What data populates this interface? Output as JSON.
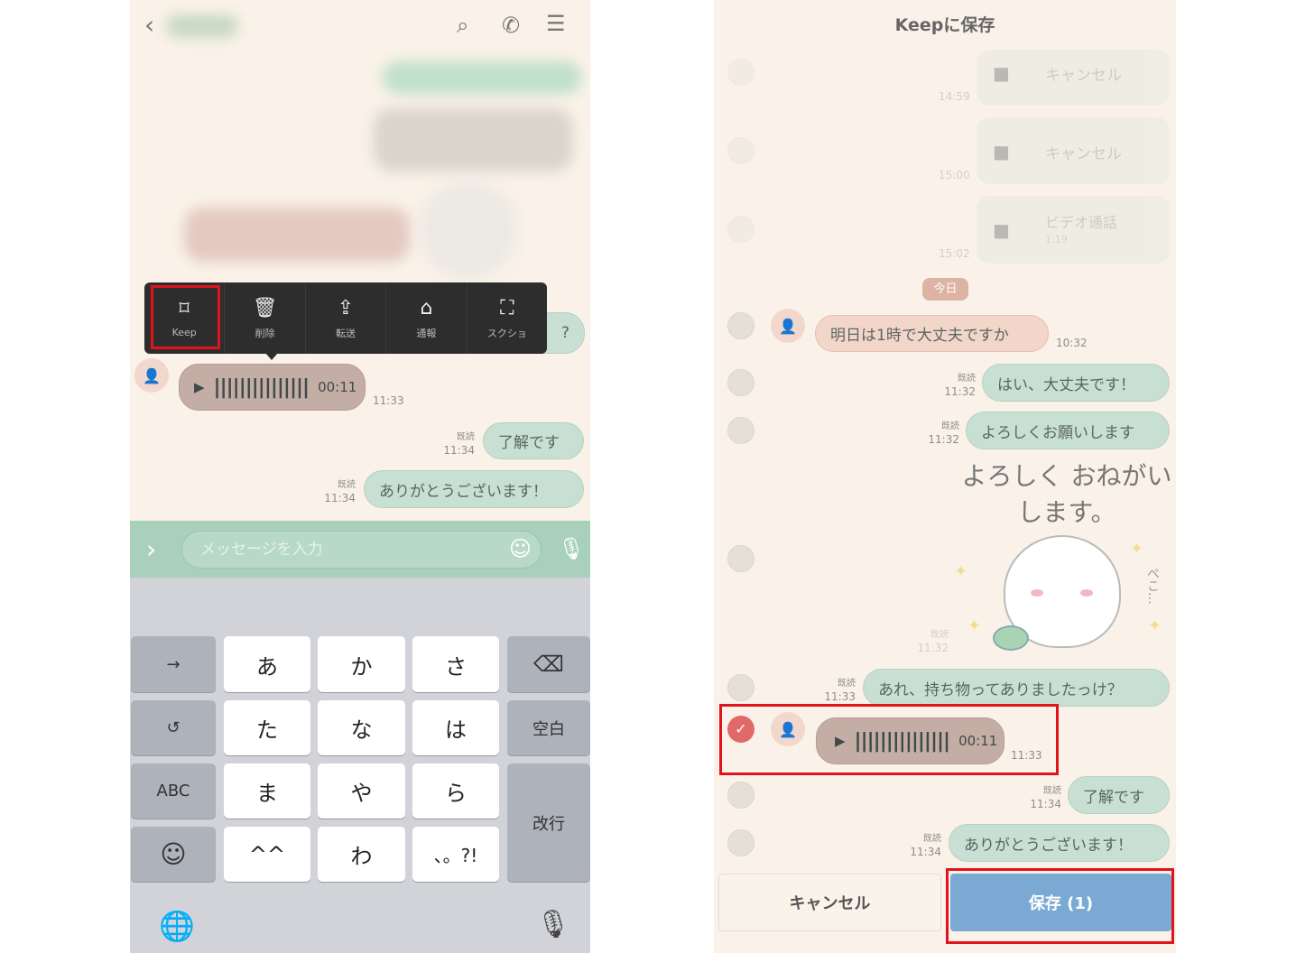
{
  "left": {
    "header": {
      "back_icon": "chevron-left-icon",
      "search_icon": "search-icon",
      "call_icon": "phone-icon",
      "menu_icon": "menu-icon"
    },
    "context_menu": [
      {
        "label": "Keep",
        "icon": "bookmark-icon"
      },
      {
        "label": "削除",
        "icon": "trash-icon"
      },
      {
        "label": "転送",
        "icon": "share-icon"
      },
      {
        "label": "通報",
        "icon": "report-icon"
      },
      {
        "label": "スクショ",
        "icon": "screenshot-icon"
      }
    ],
    "partial_bubble": "?",
    "voice_message": {
      "duration": "00:11",
      "time": "11:33"
    },
    "messages": [
      {
        "text": "了解です",
        "read": "既読",
        "time": "11:34"
      },
      {
        "text": "ありがとうございます！",
        "read": "既読",
        "time": "11:34"
      }
    ],
    "input": {
      "placeholder": "メッセージを入力"
    },
    "keyboard": {
      "keys": [
        "→",
        "あ",
        "か",
        "さ",
        "⌫",
        "↺",
        "た",
        "な",
        "は",
        "空白",
        "ABC",
        "ま",
        "や",
        "ら",
        "改行",
        "☺",
        "^^",
        "わ",
        "、。?!"
      ]
    }
  },
  "right": {
    "title": "Keepに保存",
    "faded_calls": [
      {
        "label": "キャンセル",
        "time": "14:59"
      },
      {
        "label": "キャンセル",
        "time": "15:00"
      },
      {
        "label": "ビデオ通話",
        "sub": "1:19",
        "time": "15:02"
      }
    ],
    "date_pill": "今日",
    "incoming": {
      "text": "明日は1時で大丈夫ですか",
      "time": "10:32"
    },
    "messages": [
      {
        "text": "はい、大丈夫です！",
        "read": "既読",
        "time": "11:32"
      },
      {
        "text": "よろしくお願いします",
        "read": "既読",
        "time": "11:32"
      }
    ],
    "sticker": {
      "text": "よろしく おねがいします。",
      "side_text": "ぺこ…",
      "read": "既読",
      "time": "11:32"
    },
    "question": {
      "text": "あれ、持ち物ってありましたっけ？",
      "read": "既読",
      "time": "11:33"
    },
    "voice_message": {
      "duration": "00:11",
      "time": "11:33",
      "selected": true
    },
    "messages2": [
      {
        "text": "了解です",
        "read": "既読",
        "time": "11:34"
      },
      {
        "text": "ありがとうございます！",
        "read": "既読",
        "time": "11:34"
      }
    ],
    "buttons": {
      "cancel": "キャンセル",
      "save": "保存 (1)"
    },
    "colors": {
      "save": "#7aaad4",
      "check": "#e06a6a",
      "highlight": "#e0141c"
    }
  }
}
